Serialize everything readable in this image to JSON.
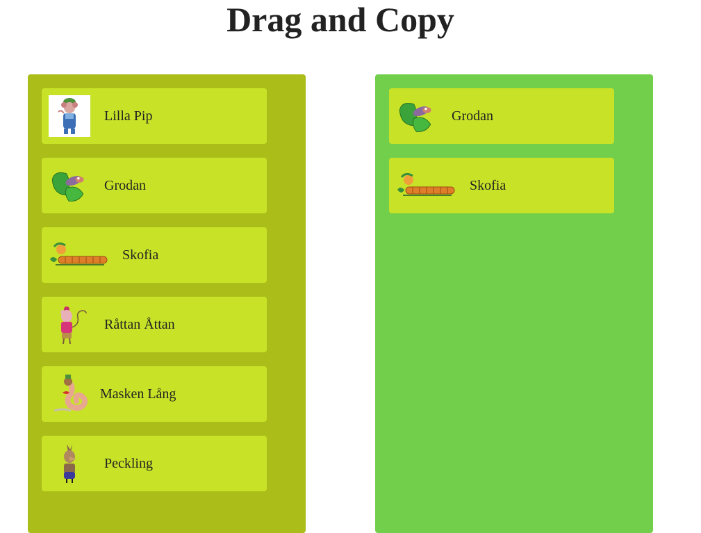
{
  "page": {
    "title": "Drag and Copy"
  },
  "colors": {
    "left_panel": "#aabd19",
    "right_panel": "#72cf4b",
    "card": "#c8e327"
  },
  "left_list": [
    {
      "name": "Lilla Pip",
      "icon": "mouse-character-icon"
    },
    {
      "name": "Grodan",
      "icon": "frog-on-leaf-icon"
    },
    {
      "name": "Skofia",
      "icon": "caterpillar-icon"
    },
    {
      "name": "Råttan Åttan",
      "icon": "rat-character-icon"
    },
    {
      "name": "Masken Lång",
      "icon": "worm-character-icon"
    },
    {
      "name": "Peckling",
      "icon": "bird-character-icon"
    }
  ],
  "right_list": [
    {
      "name": "Grodan",
      "icon": "frog-on-leaf-icon"
    },
    {
      "name": "Skofia",
      "icon": "caterpillar-icon"
    }
  ]
}
